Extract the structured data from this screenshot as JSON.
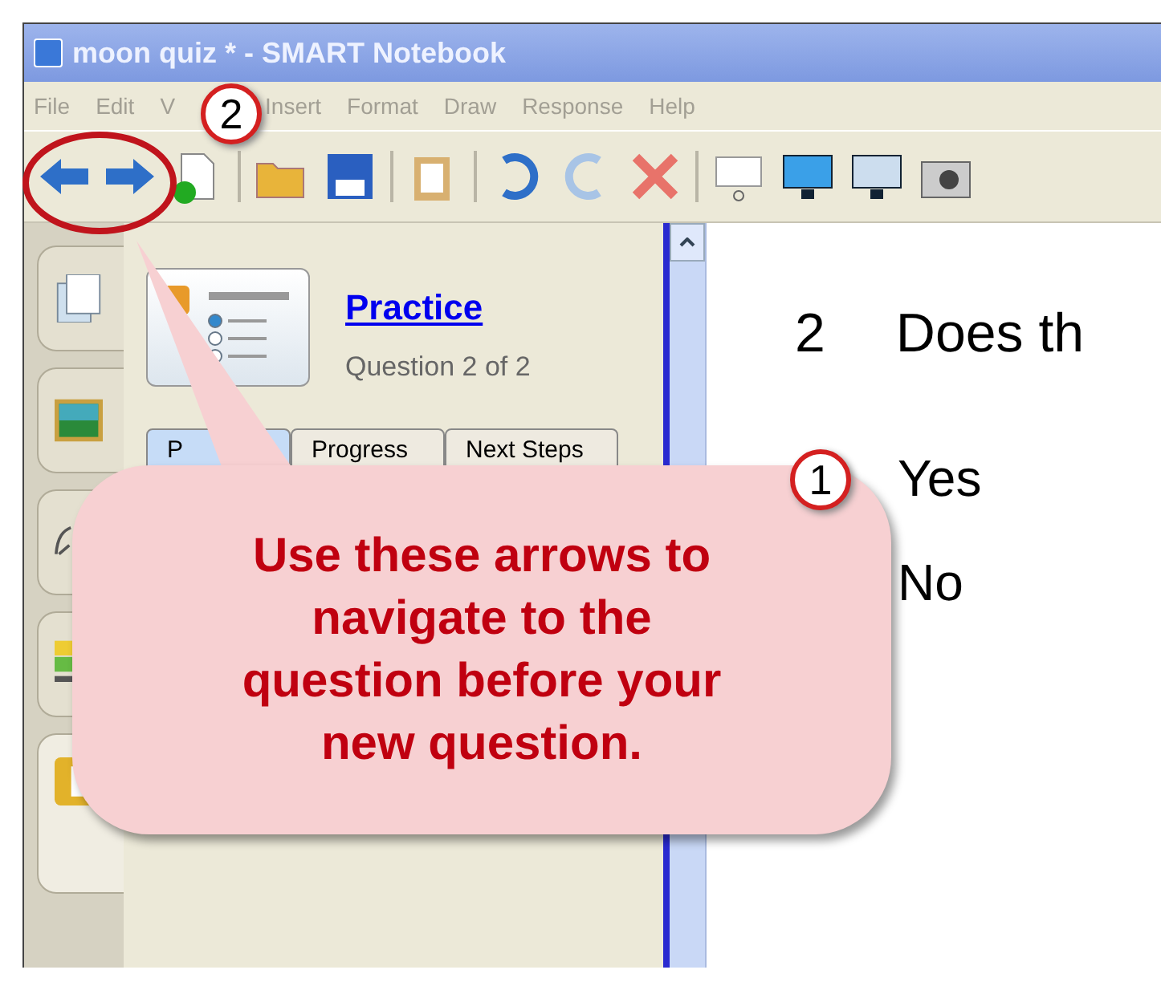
{
  "window": {
    "title": "moon quiz * - SMART Notebook"
  },
  "menu": [
    "File",
    "Edit",
    "V",
    "Insert",
    "Format",
    "Draw",
    "Response",
    "Help"
  ],
  "sidebar_tabs": [
    {
      "selected": false
    },
    {
      "selected": false
    },
    {
      "selected": false
    },
    {
      "selected": false
    },
    {
      "selected": true
    }
  ],
  "response_panel": {
    "link": "Practice",
    "subtitle": "Question 2 of 2",
    "tabs": [
      {
        "label": "P",
        "selected": true
      },
      {
        "label": "Progress",
        "selected": false
      },
      {
        "label": "Next Steps",
        "selected": false
      }
    ]
  },
  "page": {
    "number": "2",
    "question": "Does th",
    "answers": [
      "Yes",
      "No"
    ]
  },
  "callout": {
    "text": "Use these arrows to navigate to the question before your new question."
  },
  "badges": [
    "2",
    "1"
  ]
}
